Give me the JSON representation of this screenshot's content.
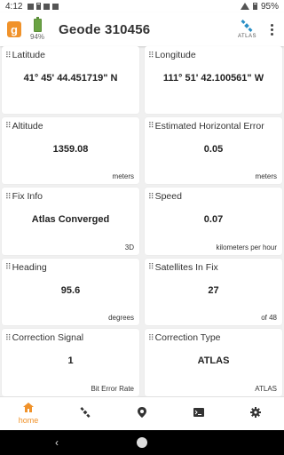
{
  "status_bar": {
    "time": "4:12",
    "battery_pct": "95%"
  },
  "app_bar": {
    "logo_letter": "g",
    "battery_pct": "94%",
    "battery_fill": 0.94,
    "device_title": "Geode 310456",
    "atlas_label": "ATLAS",
    "atlas_icon": "satellite-icon",
    "more_icon": "more-vert-icon"
  },
  "cards": [
    {
      "title": "Latitude",
      "value": "41° 45' 44.451719\" N",
      "unit": ""
    },
    {
      "title": "Longitude",
      "value": "111° 51' 42.100561\" W",
      "unit": ""
    },
    {
      "title": "Altitude",
      "value": "1359.08",
      "unit": "meters"
    },
    {
      "title": "Estimated Horizontal Error",
      "value": "0.05",
      "unit": "meters"
    },
    {
      "title": "Fix Info",
      "value": "Atlas Converged",
      "unit": "3D"
    },
    {
      "title": "Speed",
      "value": "0.07",
      "unit": "kilometers per hour"
    },
    {
      "title": "Heading",
      "value": "95.6",
      "unit": "degrees"
    },
    {
      "title": "Satellites In Fix",
      "value": "27",
      "unit": "of 48"
    },
    {
      "title": "Correction Signal",
      "value": "1",
      "unit": "Bit Error Rate"
    },
    {
      "title": "Correction Type",
      "value": "ATLAS",
      "unit": "ATLAS"
    }
  ],
  "bottom_nav": [
    {
      "icon": "home-icon",
      "label": "home",
      "active": true
    },
    {
      "icon": "satellite-icon",
      "label": "",
      "active": false
    },
    {
      "icon": "location-pin-icon",
      "label": "",
      "active": false
    },
    {
      "icon": "terminal-icon",
      "label": "",
      "active": false
    },
    {
      "icon": "settings-gear-icon",
      "label": "",
      "active": false
    }
  ],
  "colors": {
    "accent": "#f0922a",
    "atlas_blue": "#2a8fc5",
    "battery_green": "#6aa343"
  }
}
